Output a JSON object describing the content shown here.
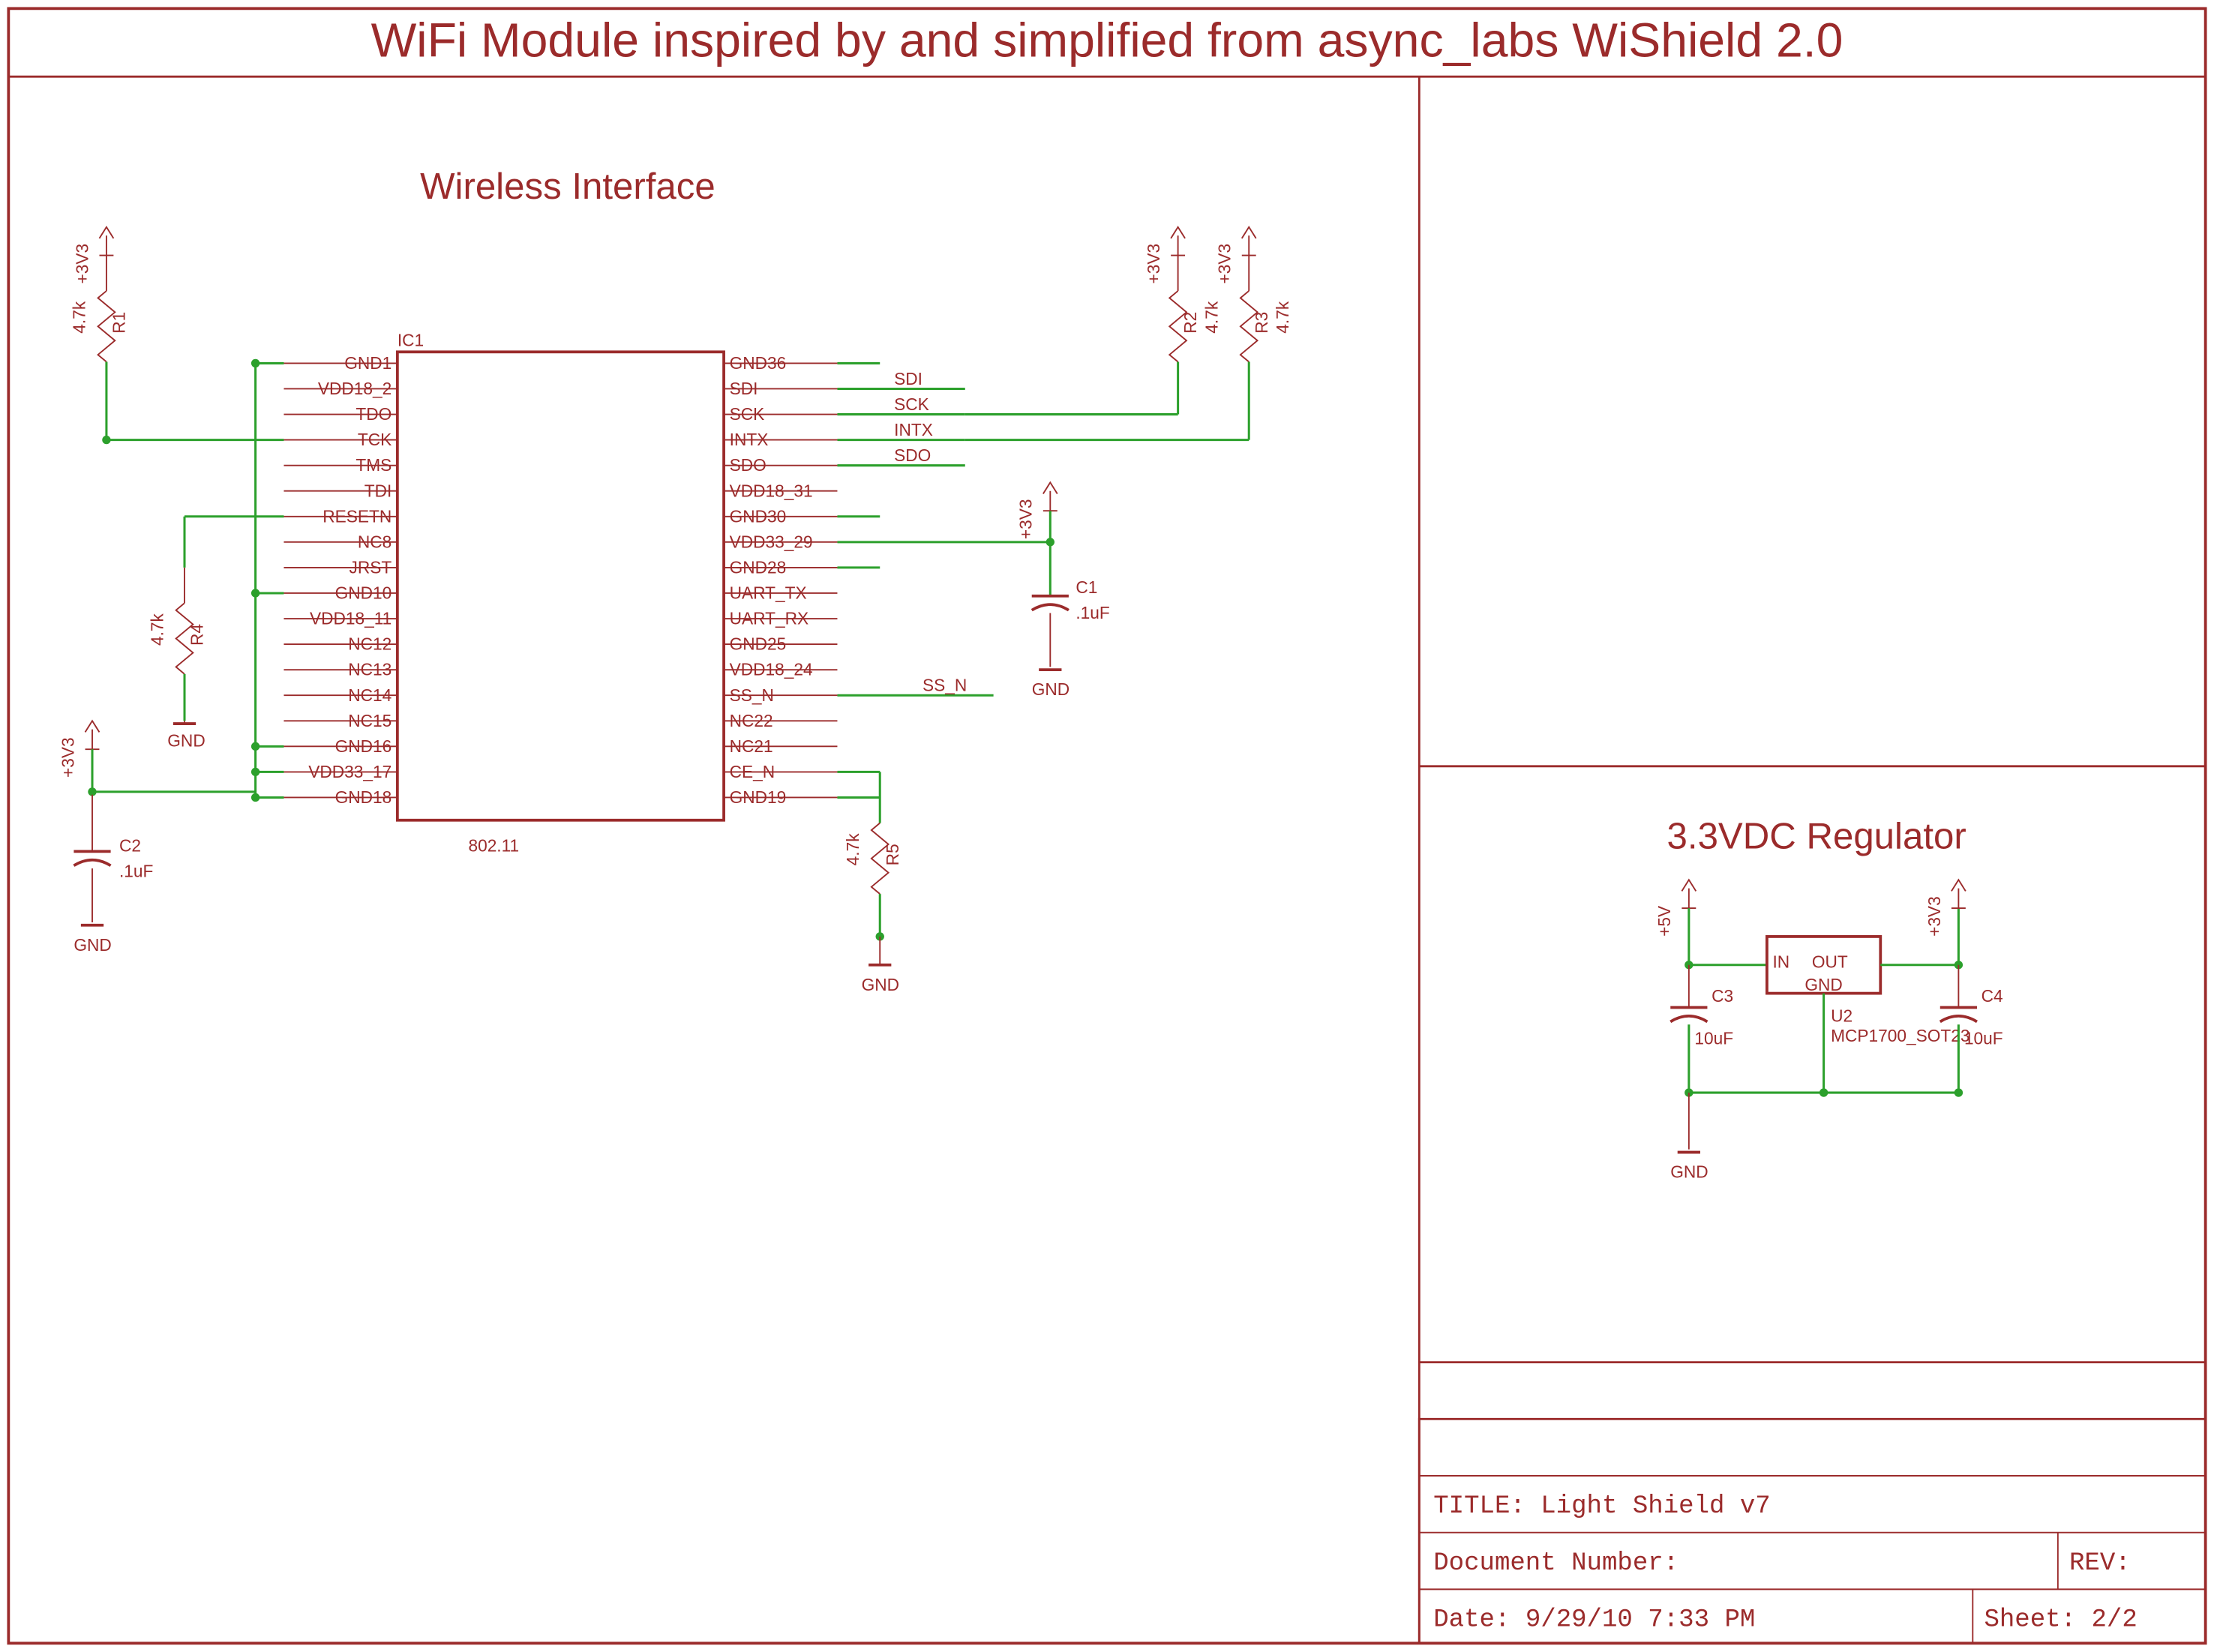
{
  "page": {
    "title": "WiFi Module inspired by and simplified from async_labs WiShield 2.0",
    "section_wireless": "Wireless Interface",
    "section_regulator": "3.3VDC Regulator"
  },
  "ic1": {
    "name": "IC1",
    "value": "802.11",
    "left_pins": [
      "GND1",
      "VDD18_2",
      "TDO",
      "TCK",
      "TMS",
      "TDI",
      "RESETN",
      "NC8",
      "JRST",
      "GND10",
      "VDD18_11",
      "NC12",
      "NC13",
      "NC14",
      "NC15",
      "GND16",
      "VDD33_17",
      "GND18"
    ],
    "right_pins": [
      "GND36",
      "SDI",
      "SCK",
      "INTX",
      "SDO",
      "VDD18_31",
      "GND30",
      "VDD33_29",
      "GND28",
      "UART_TX",
      "UART_RX",
      "GND25",
      "VDD18_24",
      "SS_N",
      "NC22",
      "NC21",
      "CE_N",
      "GND19"
    ],
    "net_labels": {
      "sdi": "SDI",
      "sck": "SCK",
      "intx": "INTX",
      "sdo": "SDO",
      "ss_n": "SS_N"
    }
  },
  "power": {
    "p3v3": "+3V3",
    "p5v": "+5V",
    "gnd": "GND"
  },
  "components": {
    "R1": {
      "name": "R1",
      "value": "4.7k"
    },
    "R2": {
      "name": "R2",
      "value": "4.7k"
    },
    "R3": {
      "name": "R3",
      "value": "4.7k"
    },
    "R4": {
      "name": "R4",
      "value": "4.7k"
    },
    "R5": {
      "name": "R5",
      "value": "4.7k"
    },
    "C1": {
      "name": "C1",
      "value": ".1uF"
    },
    "C2": {
      "name": "C2",
      "value": ".1uF"
    },
    "C3": {
      "name": "C3",
      "value": "10uF"
    },
    "C4": {
      "name": "C4",
      "value": "10uF"
    },
    "U2": {
      "name": "U2",
      "value": "MCP1700_SOT23",
      "pins": {
        "in": "IN",
        "out": "OUT",
        "gnd": "GND"
      }
    }
  },
  "titleblock": {
    "title_label": "TITLE:",
    "title_value": "Light Shield v7",
    "doc_label": "Document Number:",
    "doc_value": "",
    "rev_label": "REV:",
    "rev_value": "",
    "date_label": "Date:",
    "date_value": "9/29/10 7:33 PM",
    "sheet_label": "Sheet:",
    "sheet_value": "2/2"
  }
}
